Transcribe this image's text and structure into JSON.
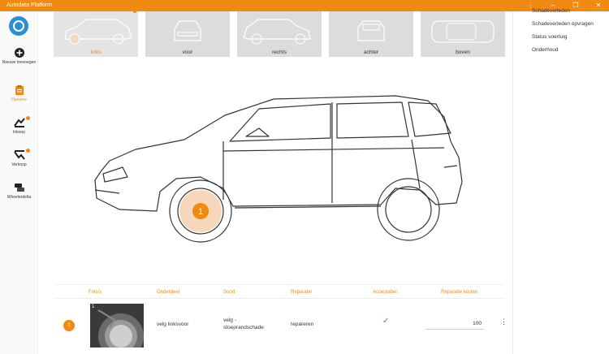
{
  "window": {
    "title": "Autodata Platform"
  },
  "sidebar": {
    "items": [
      {
        "label": "Nieuwe toevoegen",
        "icon": "plus-circle-icon"
      },
      {
        "label": "Opname",
        "icon": "clipboard-icon",
        "active": true
      },
      {
        "label": "Inkoop",
        "icon": "inkoop-icon",
        "badge": true
      },
      {
        "label": "Verkoop",
        "icon": "verkoop-icon",
        "badge": true
      },
      {
        "label": "Wheelerdelta",
        "icon": "cars-icon"
      }
    ]
  },
  "views": [
    {
      "label": "links",
      "active": true
    },
    {
      "label": "voor"
    },
    {
      "label": "rechts"
    },
    {
      "label": "achter"
    },
    {
      "label": "boven"
    }
  ],
  "damage_marker": {
    "number": "1"
  },
  "table": {
    "headers": [
      "Foto's",
      "Onderdeel",
      "Soort",
      "Reparatie",
      "Acceptabel",
      "Reparatie kosten"
    ],
    "rows": [
      {
        "num": "1",
        "photo_count": "1",
        "onderdeel": "velg linksvoor",
        "soort_line1": "velg -",
        "soort_line2": "stoeprandschade",
        "reparatie": "repareren",
        "acceptabel": "✓",
        "kosten": "100"
      }
    ]
  },
  "right_panel": {
    "items": [
      "Schadeverleden",
      "Schadeverleden opvragen",
      "Status voertuig",
      "Onderhoud"
    ]
  },
  "colors": {
    "accent": "#f08a12",
    "brand_blue": "#2b8fd6",
    "ok_green": "#3a9a3a"
  }
}
